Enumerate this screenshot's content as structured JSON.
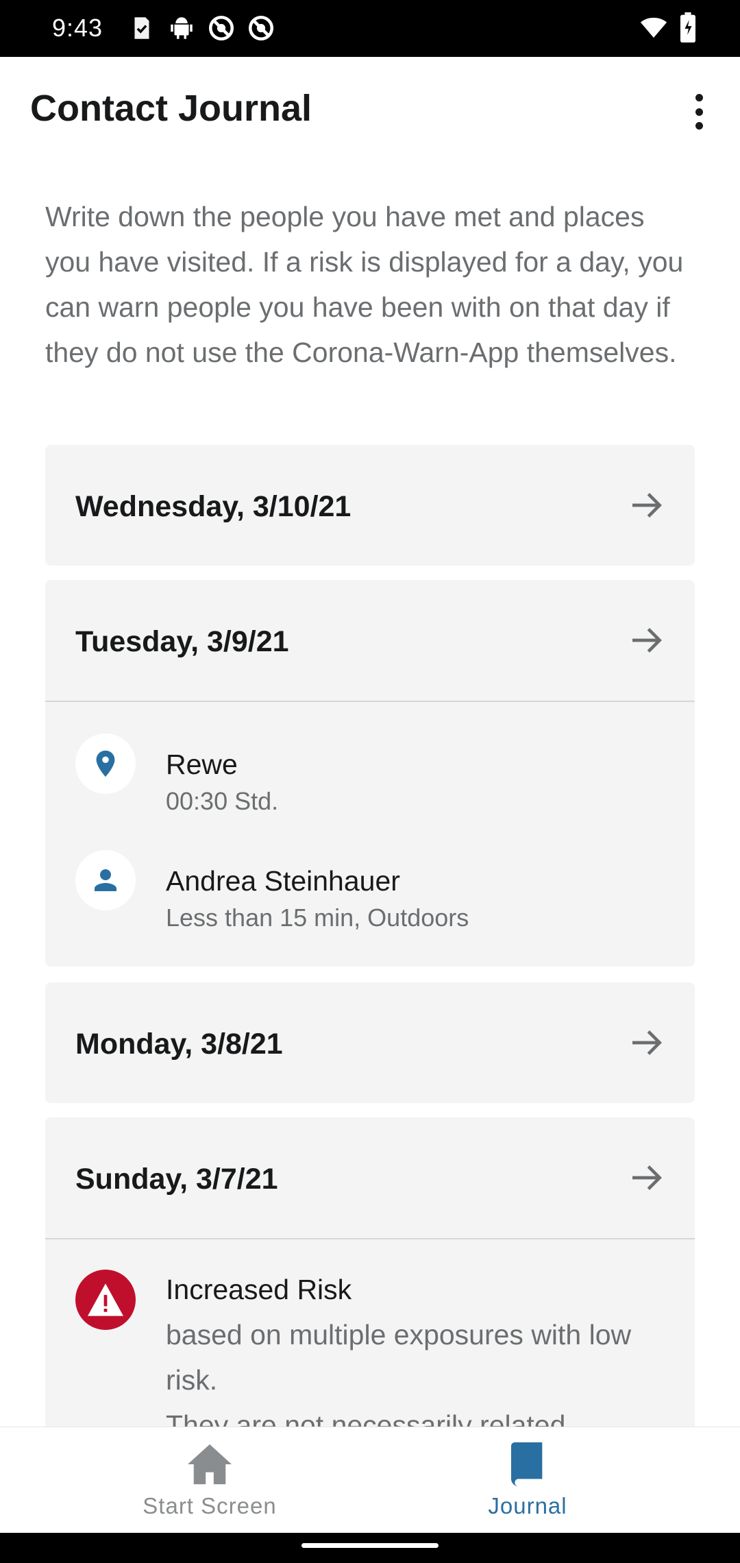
{
  "status_bar": {
    "time": "9:43",
    "left_icons": [
      "task-check-icon",
      "android-icon",
      "no-entry-icon",
      "no-entry-icon"
    ],
    "right_icons": [
      "wifi-icon",
      "battery-icon"
    ]
  },
  "app_bar": {
    "title": "Contact Journal",
    "menu_icon": "more-vert-icon"
  },
  "intro_text": "Write down the people you have met and places you have visited. If a risk is displayed for a day, you can warn people you have been with on that day if they do not use the Corona-Warn-App themselves.",
  "days": [
    {
      "date": "Wednesday, 3/10/21"
    },
    {
      "date": "Tuesday, 3/9/21",
      "entries": [
        {
          "icon": "location-pin-icon",
          "title": "Rewe",
          "subtitle": "00:30 Std."
        },
        {
          "icon": "person-icon",
          "title": "Andrea Steinhauer",
          "subtitle": "Less than 15 min, Outdoors"
        }
      ]
    },
    {
      "date": "Monday, 3/8/21"
    },
    {
      "date": "Sunday, 3/7/21",
      "risk": {
        "title": "Increased Risk",
        "text": "based on multiple exposures with low risk.",
        "text_more": "They are not necessarily related"
      }
    }
  ],
  "bottom_nav": {
    "items": [
      {
        "label": "Start Screen",
        "icon": "home-icon",
        "active": false
      },
      {
        "label": "Journal",
        "icon": "book-icon",
        "active": true
      }
    ]
  },
  "colors": {
    "accent": "#2a6fa2",
    "risk_red": "#c00f2d",
    "card_bg": "#f4f4f4",
    "muted_text": "#6b6e70"
  }
}
